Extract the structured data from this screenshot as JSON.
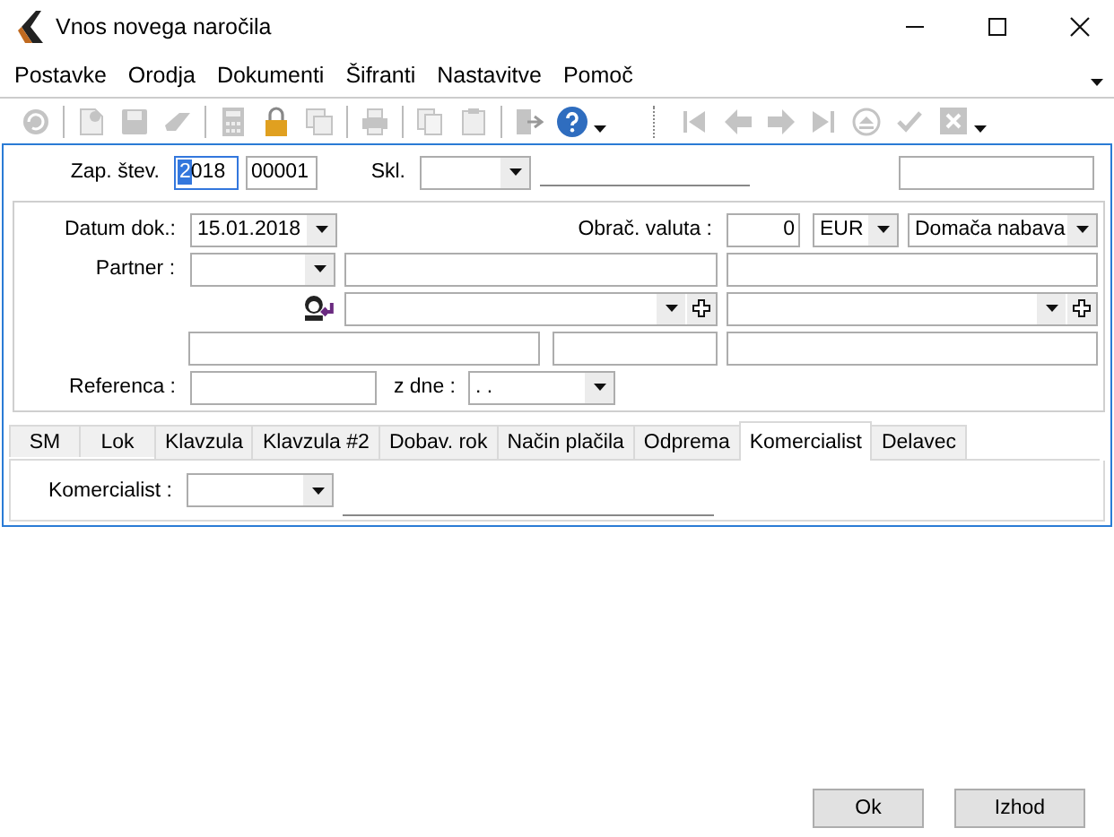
{
  "window": {
    "title": "Vnos novega naročila"
  },
  "menu": [
    "Postavke",
    "Orodja",
    "Dokumenti",
    "Šifranti",
    "Nastavitve",
    "Pomoč"
  ],
  "toolbar": [
    {
      "kind": "refresh",
      "disabled": true
    },
    {
      "kind": "separator"
    },
    {
      "kind": "pin",
      "disabled": true
    },
    {
      "kind": "save",
      "disabled": true
    },
    {
      "kind": "eraser",
      "disabled": true
    },
    {
      "kind": "separator"
    },
    {
      "kind": "calculator",
      "disabled": true
    },
    {
      "kind": "lock",
      "disabled": false
    },
    {
      "kind": "copy-table",
      "disabled": true
    },
    {
      "kind": "separator"
    },
    {
      "kind": "print",
      "disabled": true
    },
    {
      "kind": "separator"
    },
    {
      "kind": "copy",
      "disabled": true
    },
    {
      "kind": "paste",
      "disabled": true
    },
    {
      "kind": "separator"
    },
    {
      "kind": "exit",
      "disabled": true
    },
    {
      "kind": "help",
      "disabled": false
    },
    {
      "kind": "caret"
    },
    {
      "kind": "dotted"
    },
    {
      "kind": "first",
      "disabled": true
    },
    {
      "kind": "prev",
      "disabled": true
    },
    {
      "kind": "next",
      "disabled": true
    },
    {
      "kind": "last",
      "disabled": true
    },
    {
      "kind": "eject",
      "disabled": true
    },
    {
      "kind": "check",
      "disabled": true
    },
    {
      "kind": "cancel",
      "disabled": true
    },
    {
      "kind": "caret"
    }
  ],
  "header": {
    "number_label": "Zap. štev.",
    "year": {
      "selected_part": "2",
      "rest": "018"
    },
    "number": "00001",
    "warehouse_label": "Skl."
  },
  "form": {
    "date_label": "Datum dok.:",
    "date": "15.01.2018",
    "currency_label": "Obrač. valuta :",
    "rate": "0",
    "currency": "EUR",
    "purchase_type": "Domača nabava",
    "partner_label": "Partner :",
    "reference_label": "Referenca  :",
    "date_from_label": "z dne :",
    "date_from": ". ."
  },
  "tabs": [
    {
      "label": "SM",
      "selected": false
    },
    {
      "label": "Lok",
      "selected": false
    },
    {
      "label": "Klavzula",
      "selected": false
    },
    {
      "label": "Klavzula #2",
      "selected": false
    },
    {
      "label": "Dobav. rok",
      "selected": false
    },
    {
      "label": "Način plačila",
      "selected": false
    },
    {
      "label": "Odprema",
      "selected": false
    },
    {
      "label": "Komercialist",
      "selected": true
    },
    {
      "label": "Delavec",
      "selected": false
    }
  ],
  "tab_content": {
    "label": "Komercialist :"
  },
  "buttons": [
    "Ok",
    "Izhod"
  ]
}
